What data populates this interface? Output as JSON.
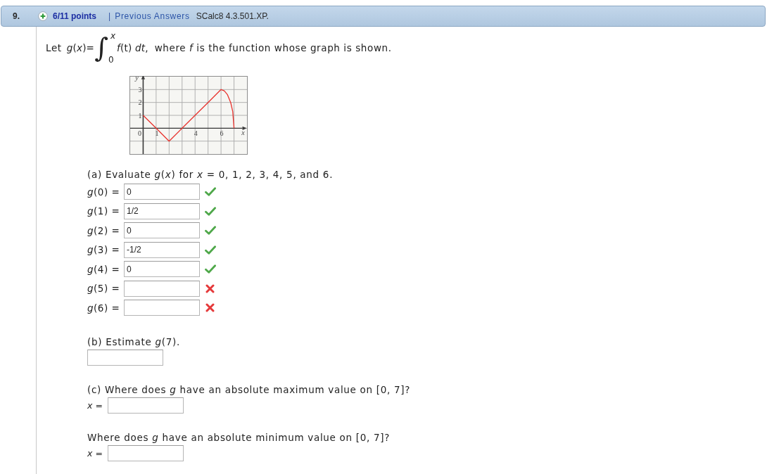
{
  "header": {
    "number": "9.",
    "score": "6/11 points",
    "separator": "|",
    "link": "Previous Answers",
    "source": "SCalc8 4.3.501.XP."
  },
  "intro": {
    "lead": "Let",
    "lhs": "*g*(*x*)=",
    "integral": {
      "sign": "∫",
      "upper": "x",
      "lower": "0"
    },
    "integrand": "*f*(t) *dt*,",
    "text": "where *f* is the function whose graph is shown."
  },
  "graph": {
    "chart_data": {
      "type": "line",
      "xlabel": "x",
      "ylabel": "y",
      "x": [
        0,
        1,
        2,
        3,
        4,
        5,
        6,
        6.25,
        6.5,
        6.75,
        6.9,
        7
      ],
      "series": [
        {
          "color": "#e8332e",
          "values": [
            1,
            0,
            -1,
            0,
            1,
            2,
            3,
            2.9,
            2.6,
            1.98,
            1.31,
            0
          ]
        }
      ],
      "xlim": [
        -1,
        8
      ],
      "ylim": [
        -2,
        4
      ],
      "xticks": [
        0,
        1,
        4,
        6
      ],
      "yticks": [
        1,
        2,
        3
      ],
      "grid": true
    }
  },
  "part_a": {
    "prompt": "(a) Evaluate *g*(*x*) for *x* = 0, 1, 2, 3, 4, 5, and 6.",
    "rows": [
      {
        "label": "*g*(0) =",
        "value": "0",
        "correct": true
      },
      {
        "label": "*g*(1) =",
        "value": "1/2",
        "correct": true
      },
      {
        "label": "*g*(2) =",
        "value": "0",
        "correct": true
      },
      {
        "label": "*g*(3) =",
        "value": "-1/2",
        "correct": true
      },
      {
        "label": "*g*(4) =",
        "value": "0",
        "correct": true
      },
      {
        "label": "*g*(5) =",
        "correct": false
      },
      {
        "label": "*g*(6) =",
        "correct": false
      }
    ]
  },
  "part_b": {
    "prompt": "(b) Estimate *g*(7)."
  },
  "part_c": {
    "questions": [
      {
        "prompt": "(c) Where does *g* have an absolute maximum value on [0, 7]?",
        "label": "*x* ="
      },
      {
        "prompt": "Where does *g* have an absolute minimum value on [0, 7]?",
        "label": "*x* ="
      }
    ]
  }
}
